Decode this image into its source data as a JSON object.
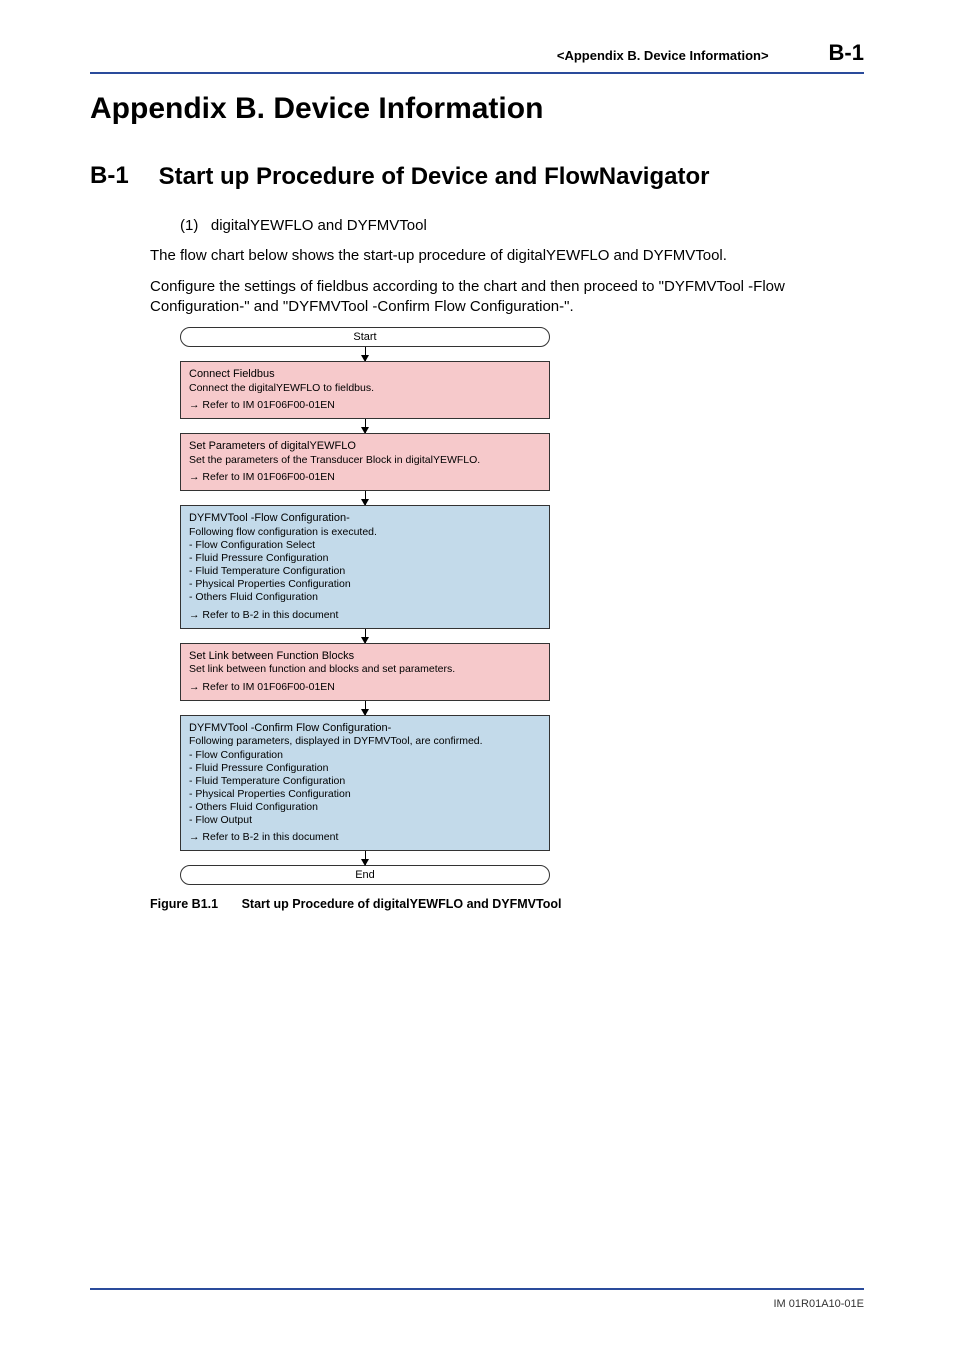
{
  "header": {
    "breadcrumb": "<Appendix B.  Device Information>",
    "pageno": "B-1"
  },
  "h1": "Appendix B. Device Information",
  "section": {
    "num": "B-1",
    "title": "Start up Procedure of Device and FlowNavigator"
  },
  "items": {
    "num": "(1)",
    "label": "digitalYEWFLO and DYFMVTool"
  },
  "para1": "The flow chart below shows the start-up procedure of digitalYEWFLO and DYFMVTool.",
  "para2": "Configure the settings of fieldbus according to the chart and then proceed to \"DYFMVTool -Flow Configuration-\" and \"DYFMVTool -Confirm Flow Configuration-\".",
  "chart_data": {
    "type": "flowchart",
    "start": "Start",
    "end": "End",
    "steps": [
      {
        "color": "pink",
        "title": "Connect Fieldbus",
        "desc": "Connect the digitalYEWFLO to fieldbus.",
        "ref": "→ Refer to IM 01F06F00-01EN"
      },
      {
        "color": "pink",
        "title": "Set Parameters of digitalYEWFLO",
        "desc": "Set the parameters of the Transducer Block in digitalYEWFLO.",
        "ref": "→ Refer to IM 01F06F00-01EN"
      },
      {
        "color": "blue",
        "title": "DYFMVTool -Flow Configuration-",
        "desc_lines": [
          "Following flow configuration is executed.",
          "- Flow Configuration Select",
          "- Fluid Pressure Configuration",
          "- Fluid Temperature Configuration",
          "- Physical Properties Configuration",
          "- Others Fluid Configuration"
        ],
        "ref": "→ Refer to B-2 in this document"
      },
      {
        "color": "pink",
        "title": "Set Link between Function Blocks",
        "desc": "Set link between function and blocks and set parameters.",
        "ref": "→ Refer to IM 01F06F00-01EN"
      },
      {
        "color": "blue",
        "title": "DYFMVTool -Confirm Flow Configuration-",
        "desc_lines": [
          "Following parameters, displayed in DYFMVTool, are confirmed.",
          "- Flow Configuration",
          "- Fluid Pressure Configuration",
          "- Fluid Temperature Configuration",
          "- Physical Properties Configuration",
          "- Others Fluid Configuration",
          "- Flow Output"
        ],
        "ref": "→ Refer to B-2 in this document"
      }
    ]
  },
  "figcaption": {
    "label": "Figure B1.1",
    "text": "Start up Procedure of digitalYEWFLO and DYFMVTool"
  },
  "footer": "IM 01R01A10-01E"
}
